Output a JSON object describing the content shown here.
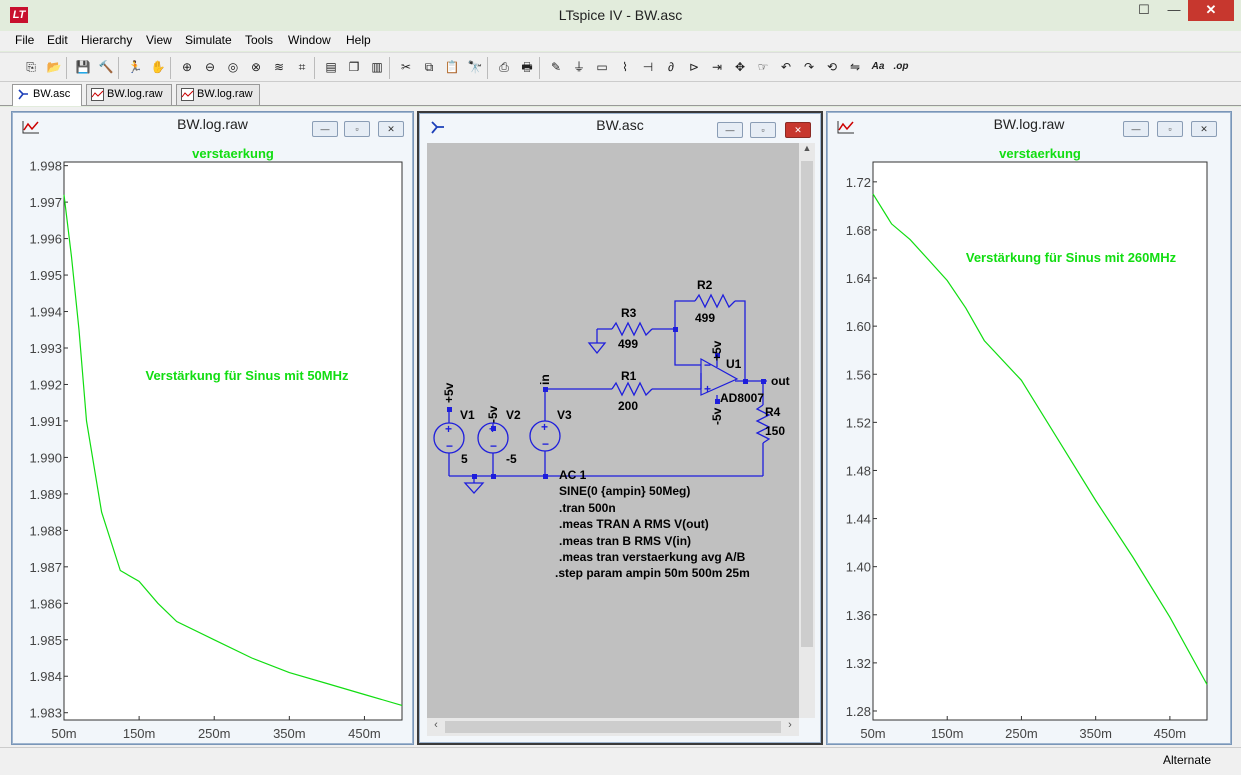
{
  "app": {
    "logo_text": "LT",
    "title": "LTspice IV - BW.asc",
    "min": "—",
    "max": "☐",
    "close": "✕"
  },
  "menu": [
    "File",
    "Edit",
    "Hierarchy",
    "View",
    "Simulate",
    "Tools",
    "Window",
    "Help"
  ],
  "toolbar_icons": [
    "new-schematic-icon",
    "open-icon",
    "save-icon",
    "control-panel-icon",
    "run-icon",
    "halt-icon",
    "zoom-in-icon",
    "zoom-out-icon",
    "zoom-fit-icon",
    "zoom-cancel-icon",
    "autorange-icon",
    "pick-trace-icon",
    "tile-horizontal-icon",
    "cascade-icon",
    "tile-vertical-icon",
    "cut-icon",
    "copy-icon",
    "paste-icon",
    "find-icon",
    "print-setup-icon",
    "print-icon",
    "draw-wire-icon",
    "ground-icon",
    "label-net-icon",
    "resistor-icon",
    "capacitor-icon",
    "inductor-icon",
    "diode-icon",
    "component-icon",
    "move-icon",
    "drag-icon",
    "undo-icon",
    "redo-icon",
    "rotate-icon",
    "mirror-icon",
    "text-icon",
    "spice-directive-icon"
  ],
  "tabs": [
    {
      "label": "BW.asc",
      "icon": "schematic-icon"
    },
    {
      "label": "BW.log.raw",
      "icon": "waveform-icon"
    },
    {
      "label": "BW.log.raw",
      "icon": "waveform-icon"
    }
  ],
  "windows": {
    "left_plot": {
      "title": "BW.log.raw",
      "btn_min": "—",
      "btn_max": "▫",
      "btn_close": "✕"
    },
    "schematic": {
      "title": "BW.asc",
      "btn_min": "—",
      "btn_max": "▫",
      "btn_close": "✕"
    },
    "right_plot": {
      "title": "BW.log.raw",
      "btn_min": "—",
      "btn_max": "▫",
      "btn_close": "✕"
    }
  },
  "chart_data": [
    {
      "type": "line",
      "title": "verstaerkung",
      "annotation": "Verstärkung für Sinus mit 50MHz",
      "x_ticks": [
        "50m",
        "150m",
        "250m",
        "350m",
        "450m"
      ],
      "y_ticks": [
        "1.998",
        "1.997",
        "1.996",
        "1.995",
        "1.994",
        "1.993",
        "1.992",
        "1.991",
        "1.990",
        "1.989",
        "1.988",
        "1.987",
        "1.986",
        "1.985",
        "1.984",
        "1.983"
      ],
      "xlim": [
        0.05,
        0.5
      ],
      "ylim": [
        1.9828,
        1.9981
      ],
      "series": [
        {
          "values": [
            [
              0.05,
              1.9972
            ],
            [
              0.06,
              1.9955
            ],
            [
              0.07,
              1.9935
            ],
            [
              0.08,
              1.991
            ],
            [
              0.1,
              1.9885
            ],
            [
              0.125,
              1.9869
            ],
            [
              0.15,
              1.9866
            ],
            [
              0.175,
              1.986
            ],
            [
              0.2,
              1.9855
            ],
            [
              0.25,
              1.985
            ],
            [
              0.3,
              1.9845
            ],
            [
              0.35,
              1.9841
            ],
            [
              0.4,
              1.9838
            ],
            [
              0.45,
              1.9835
            ],
            [
              0.5,
              1.9832
            ]
          ]
        }
      ],
      "color": "#11dd11",
      "grid": false
    },
    {
      "type": "line",
      "title": "verstaerkung",
      "annotation": "Verstärkung für Sinus mit 260MHz",
      "x_ticks": [
        "50m",
        "150m",
        "250m",
        "350m",
        "450m"
      ],
      "y_ticks": [
        "1.72",
        "1.68",
        "1.64",
        "1.60",
        "1.56",
        "1.52",
        "1.48",
        "1.44",
        "1.40",
        "1.36",
        "1.32",
        "1.28"
      ],
      "xlim": [
        0.05,
        0.5
      ],
      "ylim": [
        1.2725,
        1.7365
      ],
      "series": [
        {
          "values": [
            [
              0.05,
              1.71
            ],
            [
              0.075,
              1.685
            ],
            [
              0.1,
              1.672
            ],
            [
              0.125,
              1.655
            ],
            [
              0.15,
              1.638
            ],
            [
              0.175,
              1.615
            ],
            [
              0.2,
              1.588
            ],
            [
              0.25,
              1.555
            ],
            [
              0.3,
              1.505
            ],
            [
              0.35,
              1.455
            ],
            [
              0.4,
              1.408
            ],
            [
              0.45,
              1.358
            ],
            [
              0.5,
              1.302
            ]
          ]
        }
      ],
      "color": "#11dd11",
      "grid": false
    }
  ],
  "schematic": {
    "labels": {
      "r1": "R1",
      "r1v": "200",
      "r2": "R2",
      "r2v": "499",
      "r3": "R3",
      "r3v": "499",
      "r4": "R4",
      "r4v": "150",
      "u1": "U1",
      "u1p": "AD8007",
      "v1": "V1",
      "v1v": "5",
      "v2": "V2",
      "v2v": "-5",
      "v3": "V3",
      "p5v_a": "+5v",
      "n5v_a": "-5v",
      "p5v_u": "+5v",
      "n5v_u": "-5v",
      "in": "in",
      "out": "out"
    },
    "directives": [
      "AC 1",
      "SINE(0 {ampin} 50Meg)",
      ".tran 500n",
      ".meas TRAN A RMS V(out)",
      ".meas tran B RMS V(in)",
      ".meas tran verstaerkung avg A/B",
      ".step param ampin 50m 500m 25m"
    ]
  },
  "status": "Alternate"
}
